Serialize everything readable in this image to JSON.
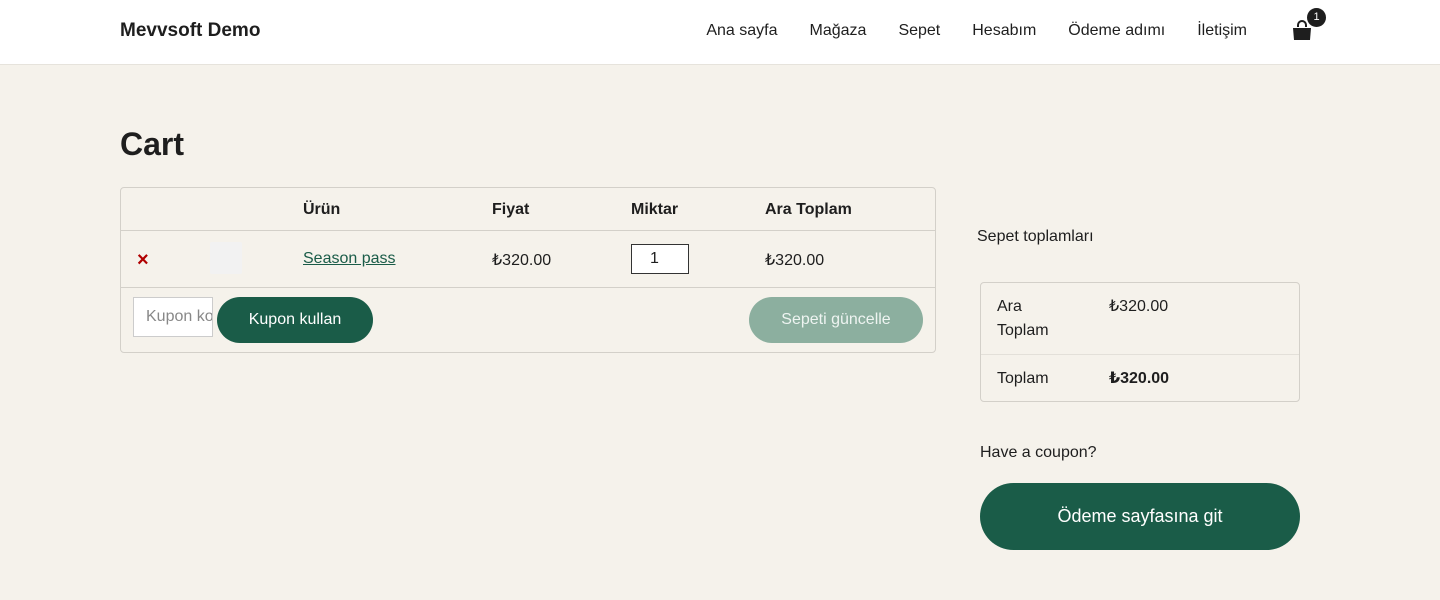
{
  "header": {
    "site_title": "Mevvsoft Demo",
    "nav": [
      "Ana sayfa",
      "Mağaza",
      "Sepet",
      "Hesabım",
      "Ödeme adımı",
      "İletişim"
    ],
    "cart_count": "1",
    "cart_icon": "shopping-bag-icon"
  },
  "page": {
    "title": "Cart"
  },
  "cart": {
    "headers": {
      "product": "Ürün",
      "price": "Fiyat",
      "quantity": "Miktar",
      "subtotal": "Ara Toplam"
    },
    "items": [
      {
        "remove_symbol": "×",
        "name": "Season pass",
        "price": "₺320.00",
        "quantity": "1",
        "subtotal": "₺320.00"
      }
    ],
    "coupon_placeholder": "Kupon kodu",
    "apply_coupon": "Kupon kullan",
    "update_cart": "Sepeti güncelle"
  },
  "totals": {
    "heading": "Sepet toplamları",
    "subtotal_label_1": "Ara",
    "subtotal_label_2": "Toplam",
    "subtotal_value": "₺320.00",
    "total_label": "Toplam",
    "total_value": "₺320.00"
  },
  "coupon_prompt": "Have a coupon?",
  "checkout_button": "Ödeme sayfasına git",
  "colors": {
    "primary": "#1a5c48",
    "primary_disabled": "#8caf9f",
    "background": "#f5f2eb",
    "remove": "#b00000"
  }
}
